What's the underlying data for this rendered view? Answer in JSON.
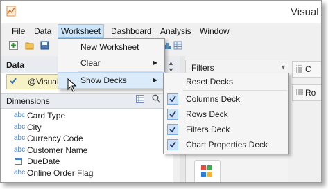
{
  "window": {
    "title": "Visual"
  },
  "menubar": {
    "items": [
      {
        "label": "File"
      },
      {
        "label": "Data"
      },
      {
        "label": "Worksheet"
      },
      {
        "label": "Dashboard"
      },
      {
        "label": "Analysis"
      },
      {
        "label": "Window"
      }
    ]
  },
  "worksheet_menu": {
    "items": [
      {
        "label": "New Worksheet"
      },
      {
        "label": "Clear"
      },
      {
        "label": "Show Decks"
      }
    ]
  },
  "decks_menu": {
    "items": [
      {
        "label": "Reset Decks",
        "checked": false
      },
      {
        "label": "Columns Deck",
        "checked": true
      },
      {
        "label": "Rows Deck",
        "checked": true
      },
      {
        "label": "Filters Deck",
        "checked": true
      },
      {
        "label": "Chart Properties Deck",
        "checked": true
      }
    ]
  },
  "data_panel": {
    "header": "Data",
    "datasource": "@Visual A",
    "dimensions_header": "Dimensions",
    "dimensions": [
      {
        "type": "abc",
        "label": "Card Type"
      },
      {
        "type": "abc",
        "label": "City"
      },
      {
        "type": "abc",
        "label": "Currency Code"
      },
      {
        "type": "abc",
        "label": "Customer Name"
      },
      {
        "type": "date",
        "label": "DueDate"
      },
      {
        "type": "abc",
        "label": "Online Order Flag"
      }
    ]
  },
  "shelves": {
    "filters_label": "Filters",
    "columns_short": "C",
    "rows_short": "Ro"
  },
  "colors": {
    "menu_highlight": "#dcebfa",
    "datasource_bg": "#f7f1c8",
    "check_accent": "#2b6fc2"
  }
}
